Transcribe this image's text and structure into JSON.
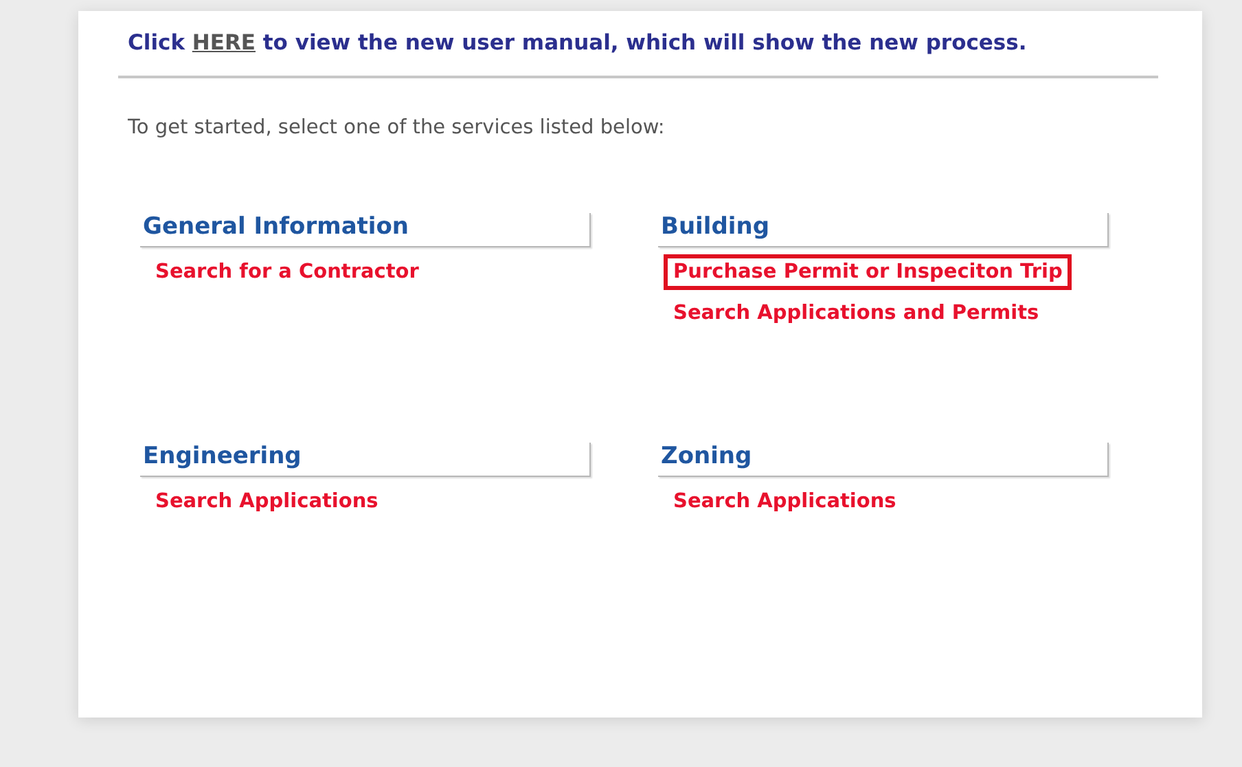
{
  "notice": {
    "before": "Click",
    "link": "HERE",
    "after": "to view the new user manual, which will show the new process."
  },
  "intro": "To get started, select one of the services listed below:",
  "sections": [
    {
      "title": "General Information",
      "links": [
        {
          "label": "Search for a Contractor",
          "highlighted": false
        }
      ]
    },
    {
      "title": "Building",
      "links": [
        {
          "label": "Purchase Permit or Inspeciton Trip",
          "highlighted": true
        },
        {
          "label": "Search Applications and Permits",
          "highlighted": false
        }
      ]
    },
    {
      "title": "Engineering",
      "links": [
        {
          "label": "Search Applications",
          "highlighted": false
        }
      ]
    },
    {
      "title": "Zoning",
      "links": [
        {
          "label": "Search Applications",
          "highlighted": false
        }
      ]
    }
  ]
}
